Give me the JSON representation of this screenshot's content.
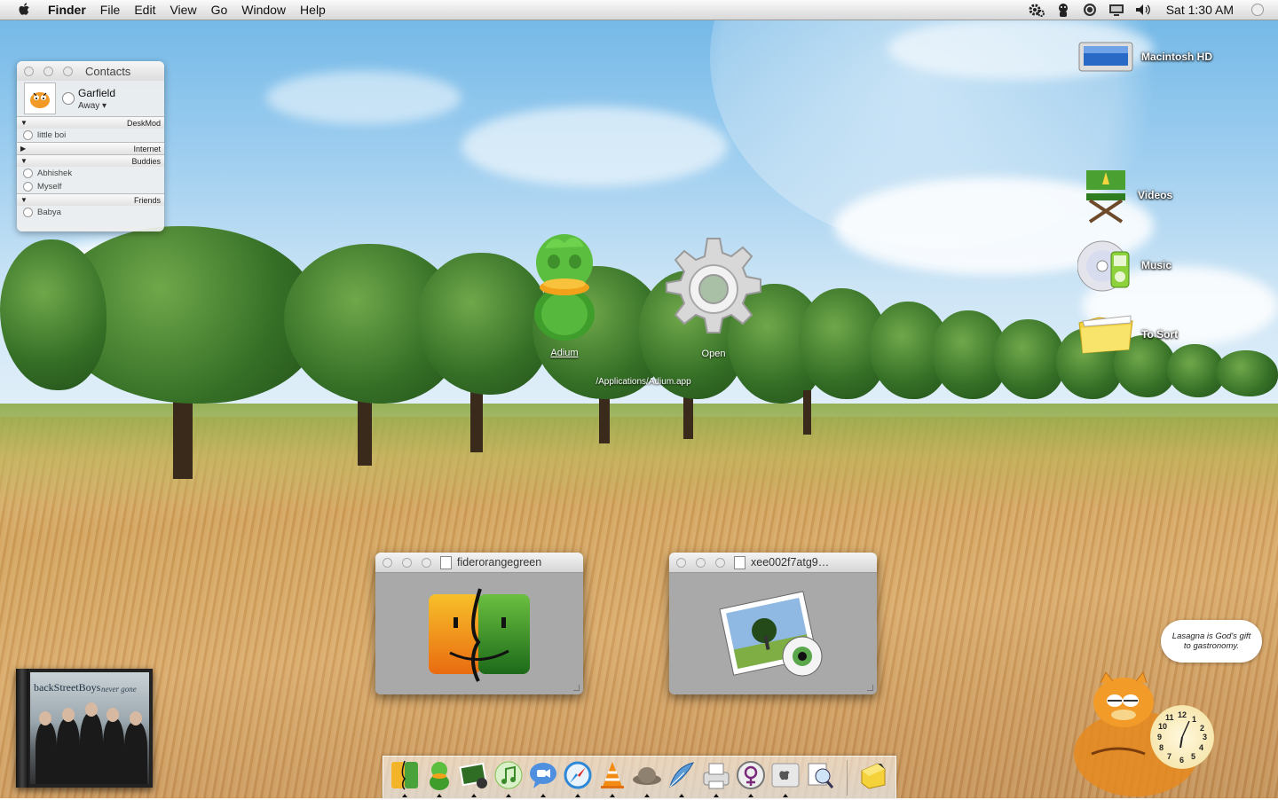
{
  "menubar": {
    "app_name": "Finder",
    "menus": [
      "File",
      "Edit",
      "View",
      "Go",
      "Window",
      "Help"
    ],
    "status_icons": [
      "gear-icon",
      "adium-status-icon",
      "sync-icon",
      "display-icon",
      "volume-icon"
    ],
    "clock": "Sat 1:30 AM"
  },
  "contacts": {
    "title": "Contacts",
    "me": {
      "name": "Garfield",
      "status": "Away",
      "avatar_caption": "Garfield"
    },
    "groups": [
      {
        "name": "DeskMod",
        "expanded": true,
        "buddies": [
          "little boi"
        ]
      },
      {
        "name": "Internet",
        "expanded": false,
        "buddies": []
      },
      {
        "name": "Buddies",
        "expanded": true,
        "buddies": [
          "Abhishek",
          "Myself"
        ]
      },
      {
        "name": "Friends",
        "expanded": true,
        "buddies": [
          "Babya"
        ]
      }
    ]
  },
  "desktop": {
    "center_icons": [
      {
        "label": "Adium"
      },
      {
        "label": "Open"
      }
    ],
    "path_label": "/Applications/Adium.app",
    "right_icons": [
      {
        "label": "Macintosh HD",
        "icon": "hard-drive-icon"
      },
      {
        "label": "Videos",
        "icon": "director-chair-icon"
      },
      {
        "label": "Music",
        "icon": "cd-ipod-icon"
      },
      {
        "label": "To Sort",
        "icon": "folder-icon"
      }
    ]
  },
  "windows": [
    {
      "title": "fiderorangegreen",
      "icon": "finder-icon"
    },
    {
      "title": "xee002f7atg9…",
      "icon": "preview-icon"
    }
  ],
  "album": {
    "artist": "backStreetBoys",
    "album": "never gone"
  },
  "garfield_widget": {
    "quote_line1": "Lasagna is God's gift",
    "quote_line2": "to gastronomy.",
    "clock_numbers": [
      "12",
      "1",
      "2",
      "3",
      "4",
      "5",
      "6",
      "7",
      "8",
      "9",
      "10",
      "11"
    ]
  },
  "dock": {
    "items": [
      {
        "name": "finder-icon"
      },
      {
        "name": "adium-icon"
      },
      {
        "name": "photo-icon"
      },
      {
        "name": "itunes-icon"
      },
      {
        "name": "ichat-icon"
      },
      {
        "name": "safari-icon"
      },
      {
        "name": "vlc-icon"
      },
      {
        "name": "camino-icon"
      },
      {
        "name": "mail-icon"
      },
      {
        "name": "printer-icon"
      },
      {
        "name": "system-prefs-icon"
      },
      {
        "name": "apple-icon"
      },
      {
        "name": "preview-icon"
      }
    ],
    "trailing_items": [
      {
        "name": "stickies-icon"
      }
    ]
  },
  "colors": {
    "accent": "#3b7fd0",
    "menubar_bg": "#e8e8e8"
  }
}
